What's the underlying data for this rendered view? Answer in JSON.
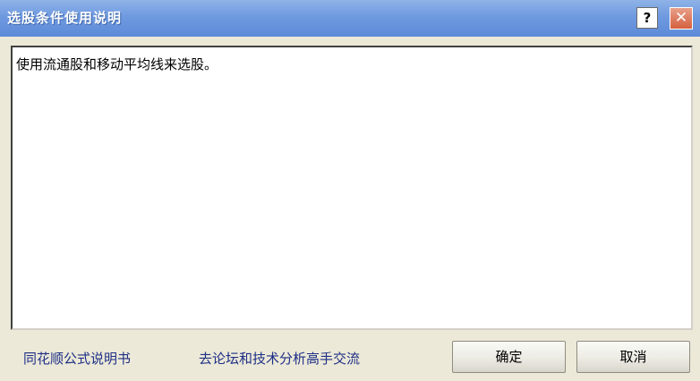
{
  "window": {
    "title": "选股条件使用说明",
    "help_symbol": "?",
    "close_symbol": "✕"
  },
  "description": {
    "text": "使用流通股和移动平均线来选股。"
  },
  "links": {
    "manual": "同花顺公式说明书",
    "forum": "去论坛和技术分析高手交流"
  },
  "buttons": {
    "ok": "确定",
    "cancel": "取消"
  }
}
